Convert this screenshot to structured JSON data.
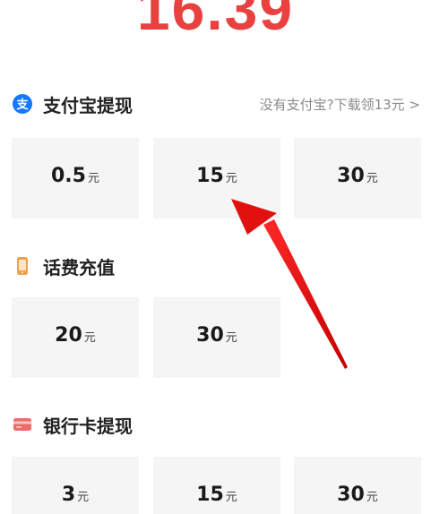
{
  "balance": {
    "value": "16.39",
    "color": "#e8413f"
  },
  "alipay": {
    "title": "支付宝提现",
    "icon": "alipay-icon",
    "promo_link": "没有支付宝?下载领13元 >",
    "options": [
      {
        "amount": "0.5",
        "unit": "元"
      },
      {
        "amount": "15",
        "unit": "元"
      },
      {
        "amount": "30",
        "unit": "元"
      }
    ]
  },
  "phone_recharge": {
    "title": "话费充值",
    "icon": "phone-icon",
    "options": [
      {
        "amount": "20",
        "unit": "元"
      },
      {
        "amount": "30",
        "unit": "元"
      }
    ]
  },
  "bank_card": {
    "title": "银行卡提现",
    "icon": "bank-card-icon",
    "options": [
      {
        "amount": "3",
        "unit": "元"
      },
      {
        "amount": "15",
        "unit": "元"
      },
      {
        "amount": "30",
        "unit": "元"
      }
    ]
  },
  "colors": {
    "accent_red": "#e8413f",
    "alipay_blue": "#1677ff",
    "phone_orange": "#f0a04b",
    "card_red": "#ef6b6b",
    "tile_bg": "#f5f5f5"
  }
}
